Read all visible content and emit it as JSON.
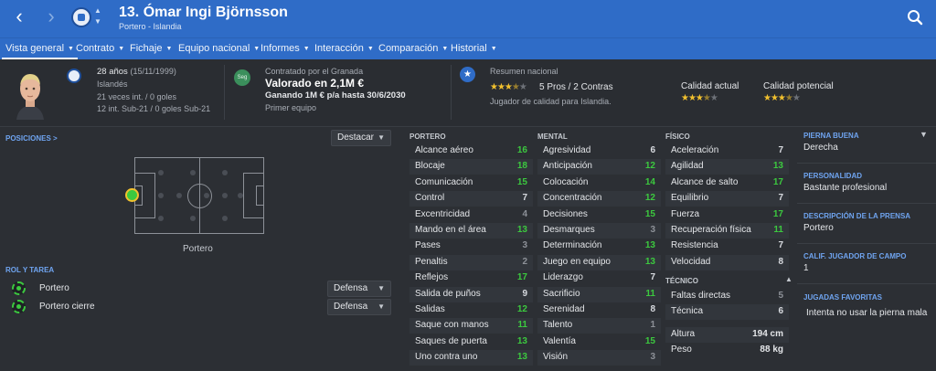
{
  "header": {
    "title": "13. Ómar Ingi Björnsson",
    "subtitle": "Portero - Islandia"
  },
  "tabs": [
    {
      "label": "Vista general"
    },
    {
      "label": "Contrato"
    },
    {
      "label": "Fichaje"
    },
    {
      "label": "Equipo nacional"
    },
    {
      "label": "Informes"
    },
    {
      "label": "Interacción"
    },
    {
      "label": "Comparación"
    },
    {
      "label": "Historial"
    }
  ],
  "bio": {
    "age": "28 años",
    "dob": "(15/11/1999)",
    "nationality": "Islandés",
    "caps": "21 veces int. / 0 goles",
    "u21": "12 int. Sub-21 / 0 goles Sub-21"
  },
  "contract": {
    "badge": "Seg",
    "contracted_by": "Contratado por el Granada",
    "value": "Valorado en 2,1M €",
    "wage": "Ganando 1M € p/a hasta 30/6/2030",
    "squad": "Primer equipo"
  },
  "national": {
    "title": "Resumen nacional",
    "summary": "5 Pros / 2 Contras",
    "description": "Jugador de calidad para Islandia.",
    "stars": "3.5"
  },
  "ability": {
    "current_label": "Calidad actual",
    "current_stars": "3.5",
    "potential_label": "Calidad potencial",
    "potential_stars": "3.5"
  },
  "positions": {
    "link": "POSICIONES >",
    "highlight_select": "Destacar",
    "position_label": "Portero"
  },
  "roles": {
    "title": "ROL Y TAREA",
    "items": [
      {
        "name": "Portero",
        "duty": "Defensa"
      },
      {
        "name": "Portero cierre",
        "duty": "Defensa"
      }
    ]
  },
  "attributes": {
    "goalkeeping_title": "PORTERO",
    "goalkeeping": [
      {
        "name": "Alcance aéreo",
        "value": "16"
      },
      {
        "name": "Blocaje",
        "value": "18"
      },
      {
        "name": "Comunicación",
        "value": "15"
      },
      {
        "name": "Control",
        "value": "7"
      },
      {
        "name": "Excentricidad",
        "value": "4"
      },
      {
        "name": "Mando en el área",
        "value": "13"
      },
      {
        "name": "Pases",
        "value": "3"
      },
      {
        "name": "Penaltis",
        "value": "2"
      },
      {
        "name": "Reflejos",
        "value": "17"
      },
      {
        "name": "Salida de puños",
        "value": "9"
      },
      {
        "name": "Salidas",
        "value": "12"
      },
      {
        "name": "Saque con manos",
        "value": "11"
      },
      {
        "name": "Saques de puerta",
        "value": "13"
      },
      {
        "name": "Uno contra uno",
        "value": "13"
      }
    ],
    "mental_title": "MENTAL",
    "mental": [
      {
        "name": "Agresividad",
        "value": "6"
      },
      {
        "name": "Anticipación",
        "value": "12"
      },
      {
        "name": "Colocación",
        "value": "14"
      },
      {
        "name": "Concentración",
        "value": "12"
      },
      {
        "name": "Decisiones",
        "value": "15"
      },
      {
        "name": "Desmarques",
        "value": "3"
      },
      {
        "name": "Determinación",
        "value": "13"
      },
      {
        "name": "Juego en equipo",
        "value": "13"
      },
      {
        "name": "Liderazgo",
        "value": "7"
      },
      {
        "name": "Sacrificio",
        "value": "11"
      },
      {
        "name": "Serenidad",
        "value": "8"
      },
      {
        "name": "Talento",
        "value": "1"
      },
      {
        "name": "Valentía",
        "value": "15"
      },
      {
        "name": "Visión",
        "value": "3"
      }
    ],
    "physical_title": "FÍSICO",
    "physical": [
      {
        "name": "Aceleración",
        "value": "7"
      },
      {
        "name": "Agilidad",
        "value": "13"
      },
      {
        "name": "Alcance de salto",
        "value": "17"
      },
      {
        "name": "Equilibrio",
        "value": "7"
      },
      {
        "name": "Fuerza",
        "value": "17"
      },
      {
        "name": "Recuperación física",
        "value": "11"
      },
      {
        "name": "Resistencia",
        "value": "7"
      },
      {
        "name": "Velocidad",
        "value": "8"
      }
    ],
    "technical_title": "TÉCNICO",
    "technical": [
      {
        "name": "Faltas directas",
        "value": "5"
      },
      {
        "name": "Técnica",
        "value": "6"
      }
    ],
    "height_label": "Altura",
    "height": "194 cm",
    "weight_label": "Peso",
    "weight": "88 kg"
  },
  "sidebar": {
    "foot_title": "PIERNA BUENA",
    "foot": "Derecha",
    "personality_title": "PERSONALIDAD",
    "personality": "Bastante profesional",
    "media_title": "DESCRIPCIÓN DE LA PRENSA",
    "media": "Portero",
    "outfield_title": "CALIF. JUGADOR DE CAMPO",
    "outfield": "1",
    "ppm_title": "JUGADAS FAVORITAS",
    "ppm": "Intenta no usar la pierna mala"
  },
  "colors": {
    "header_blue": "#2f6cc7",
    "accent_green": "#3cc93f",
    "star_gold": "#f2c12e",
    "link_blue": "#6fa4f0"
  }
}
